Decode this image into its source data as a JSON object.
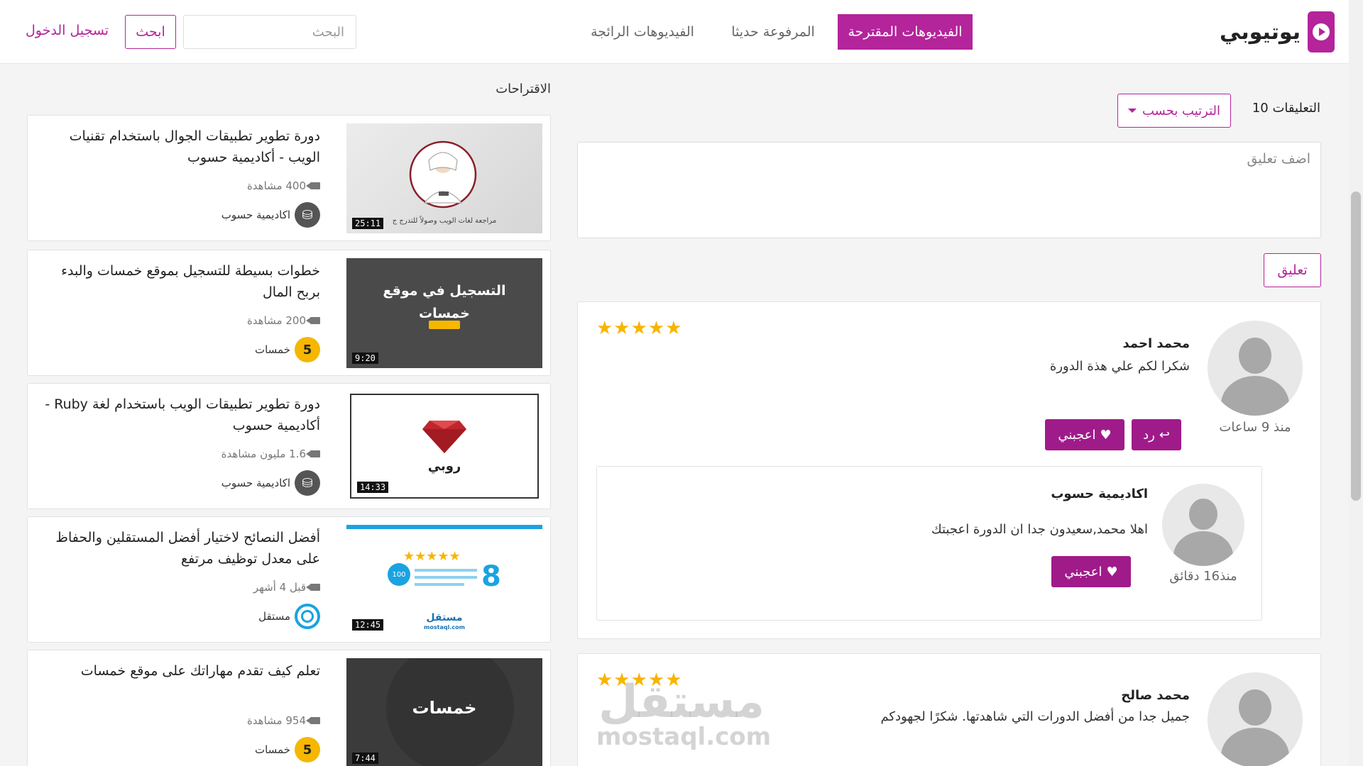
{
  "header": {
    "logo_text": "يوتيوبي",
    "tabs": [
      {
        "label": "الفيديوهات المقترحة"
      },
      {
        "label": "المرفوعة حديثا"
      },
      {
        "label": "الفيديوهات الرائجة"
      }
    ],
    "search": {
      "placeholder": "البحث",
      "button": "ابحث"
    },
    "login": "تسجيل الدخول"
  },
  "suggestions": {
    "title": "الاقتراحات",
    "items": [
      {
        "title": "دورة تطوير تطبيقات الجوال باستخدام تقنيات الويب - أكاديمية حسوب",
        "views": "400 مشاهدة",
        "channel": "اكاديمية حسوب",
        "duration": "25:11",
        "thumb_caption": "مراجعة لغات الويب وصولاً للتدرج ج"
      },
      {
        "title": "خطوات بسيطة للتسجيل بموقع خمسات والبدء بربح المال",
        "views": "200 مشاهدة",
        "channel": "خمسات",
        "duration": "9:20",
        "thumb_line1": "التسجيل في موقع",
        "thumb_line2": "خمسات"
      },
      {
        "title": "دورة تطوير تطبيقات الويب باستخدام لغة Ruby - أكاديمية حسوب",
        "views": "1.6 مليون مشاهدة",
        "channel": "اكاديمية حسوب",
        "duration": "14:33",
        "thumb_label": "روبي"
      },
      {
        "title": "أفضل النصائح لاختيار أفضل المستقلين والحفاظ على معدل توظيف مرتفع",
        "views": "قبل 4 أشهر",
        "channel": "مستقل",
        "duration": "12:45",
        "thumb_number": "8",
        "thumb_badge": "100",
        "thumb_brand": "مستقل",
        "thumb_brand_url": "mostaql.com"
      },
      {
        "title": "تعلم كيف تقدم مهاراتك على موقع خمسات",
        "views": "954 مشاهدة",
        "channel": "خمسات",
        "duration": "7:44",
        "thumb_label": "خمسات"
      }
    ]
  },
  "comments": {
    "count_label": "التعليقات 10",
    "sort_label": "الترتيب بحسب",
    "input_placeholder": "اضف تعليق",
    "submit_label": "تعليق",
    "items": [
      {
        "name": "محمد احمد",
        "text": "شكرا لكم علي هذة الدورة",
        "time": "منذ 9 ساعات",
        "rating": 5,
        "stars": "★★★★★",
        "reply_label": "رد",
        "like_label": "اعجبني",
        "replies": [
          {
            "name": "اكاديمية حسوب",
            "text": "اهلا محمد,سعيدون جدا ان الدورة اعجبتك",
            "time": "منذ16 دقائق",
            "like_label": "اعجبني"
          }
        ]
      },
      {
        "name": "محمد صالح",
        "text": "جميل جدا من أفضل الدورات التي شاهدتها. شكرًا لجهودكم",
        "rating": 5,
        "stars": "★★★★★"
      }
    ]
  },
  "watermark": {
    "ar": "مستقل",
    "en": "mostaql.com"
  },
  "colors": {
    "accent": "#b4249b",
    "button_dark": "#a01b8a",
    "star": "#f7b500"
  }
}
